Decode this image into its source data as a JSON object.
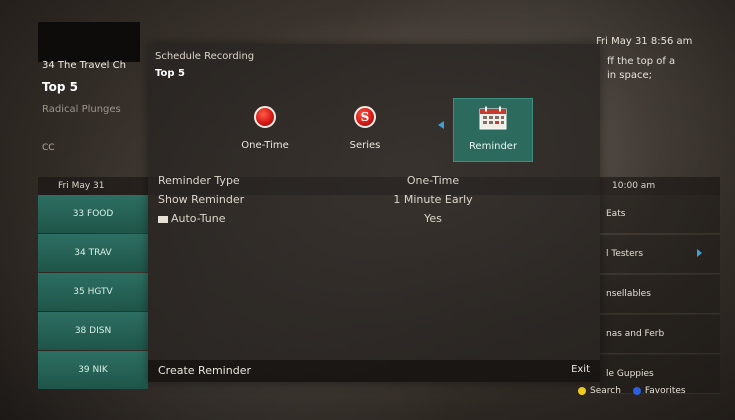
{
  "background": {
    "channel_name": "34 The Travel Ch",
    "program_title": "Top 5",
    "episode_title": "Radical Plunges",
    "cc_label": "CC",
    "datetime": "Fri  May 31 8:56 am",
    "description": "ff the top of a\nin space;",
    "grid": {
      "day_label": "Fri May 31",
      "time_label": "10:00 am",
      "channels": [
        "33 FOOD",
        "34 TRAV",
        "35 HGTV",
        "38 DISN",
        "39 NIK"
      ],
      "programs": [
        "Eats",
        "l Testers",
        "nsellables",
        "nas and Ferb",
        "le Guppies"
      ]
    },
    "legend": {
      "search_label": "Search",
      "favorites_label": "Favorites",
      "search_color": "#f2d01f",
      "favorites_color": "#2a5fe0"
    }
  },
  "dialog": {
    "title": "Schedule Recording",
    "subtitle": "Top 5",
    "options": [
      {
        "label": "One-Time",
        "icon": "record-dot-icon",
        "selected": false
      },
      {
        "label": "Series",
        "icon": "series-icon",
        "selected": false
      },
      {
        "label": "Reminder",
        "icon": "calendar-icon",
        "selected": true
      }
    ],
    "rows": [
      {
        "key": "Reminder Type",
        "value": "One-Time"
      },
      {
        "key": "Show Reminder",
        "value": "1 Minute Early"
      },
      {
        "key": "Auto-Tune",
        "value": "Yes",
        "icon": "tv-icon"
      }
    ],
    "footer": {
      "action_label": "Create Reminder",
      "exit_label": "Exit"
    }
  },
  "colors": {
    "selection": "#2b6a5d",
    "channel_cell": "#2d6f62",
    "arrow_accent": "#3aa3d6",
    "record_red": "#d51a14"
  }
}
